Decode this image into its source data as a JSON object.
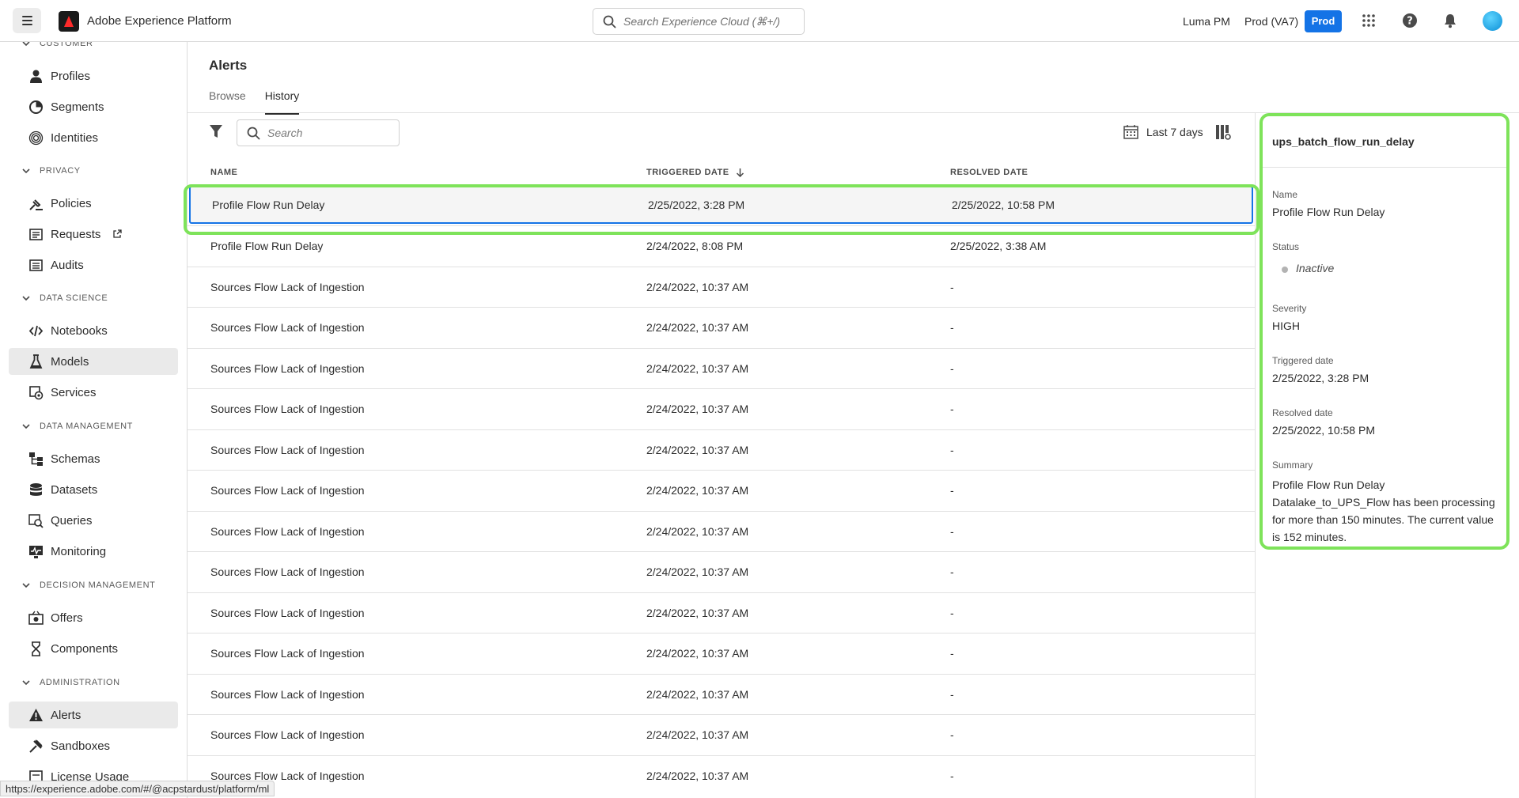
{
  "topbar": {
    "app_title": "Adobe Experience Platform",
    "search_placeholder": "Search Experience Cloud (⌘+/)",
    "org_name": "Luma PM",
    "sandbox_name": "Prod (VA7)",
    "env_badge": "Prod"
  },
  "sidebar": {
    "sections": [
      {
        "title": "CUSTOMER"
      },
      {
        "title": "PRIVACY"
      },
      {
        "title": "DATA SCIENCE"
      },
      {
        "title": "DATA MANAGEMENT"
      },
      {
        "title": "DECISION MANAGEMENT"
      },
      {
        "title": "ADMINISTRATION"
      }
    ],
    "items": {
      "profiles": "Profiles",
      "segments": "Segments",
      "identities": "Identities",
      "policies": "Policies",
      "requests": "Requests",
      "audits": "Audits",
      "notebooks": "Notebooks",
      "models": "Models",
      "services": "Services",
      "schemas": "Schemas",
      "datasets": "Datasets",
      "queries": "Queries",
      "monitoring": "Monitoring",
      "offers": "Offers",
      "components": "Components",
      "alerts": "Alerts",
      "sandboxes": "Sandboxes",
      "license_usage": "License Usage"
    },
    "active_item": "Models"
  },
  "main": {
    "page_title": "Alerts",
    "tabs": [
      "Browse",
      "History"
    ],
    "active_tab": "History",
    "search_placeholder": "Search",
    "date_range": "Last 7 days",
    "columns": {
      "name": "NAME",
      "triggered": "TRIGGERED DATE",
      "resolved": "RESOLVED DATE"
    },
    "rows": [
      {
        "name": "Profile Flow Run Delay",
        "triggered": "2/25/2022, 3:28 PM",
        "resolved": "2/25/2022, 10:58 PM"
      },
      {
        "name": "Profile Flow Run Delay",
        "triggered": "2/24/2022, 8:08 PM",
        "resolved": "2/25/2022, 3:38 AM"
      },
      {
        "name": "Sources Flow Lack of Ingestion",
        "triggered": "2/24/2022, 10:37 AM",
        "resolved": "-"
      },
      {
        "name": "Sources Flow Lack of Ingestion",
        "triggered": "2/24/2022, 10:37 AM",
        "resolved": "-"
      },
      {
        "name": "Sources Flow Lack of Ingestion",
        "triggered": "2/24/2022, 10:37 AM",
        "resolved": "-"
      },
      {
        "name": "Sources Flow Lack of Ingestion",
        "triggered": "2/24/2022, 10:37 AM",
        "resolved": "-"
      },
      {
        "name": "Sources Flow Lack of Ingestion",
        "triggered": "2/24/2022, 10:37 AM",
        "resolved": "-"
      },
      {
        "name": "Sources Flow Lack of Ingestion",
        "triggered": "2/24/2022, 10:37 AM",
        "resolved": "-"
      },
      {
        "name": "Sources Flow Lack of Ingestion",
        "triggered": "2/24/2022, 10:37 AM",
        "resolved": "-"
      },
      {
        "name": "Sources Flow Lack of Ingestion",
        "triggered": "2/24/2022, 10:37 AM",
        "resolved": "-"
      },
      {
        "name": "Sources Flow Lack of Ingestion",
        "triggered": "2/24/2022, 10:37 AM",
        "resolved": "-"
      },
      {
        "name": "Sources Flow Lack of Ingestion",
        "triggered": "2/24/2022, 10:37 AM",
        "resolved": "-"
      },
      {
        "name": "Sources Flow Lack of Ingestion",
        "triggered": "2/24/2022, 10:37 AM",
        "resolved": "-"
      },
      {
        "name": "Sources Flow Lack of Ingestion",
        "triggered": "2/24/2022, 10:37 AM",
        "resolved": "-"
      },
      {
        "name": "Sources Flow Lack of Ingestion",
        "triggered": "2/24/2022, 10:37 AM",
        "resolved": "-"
      }
    ]
  },
  "detail": {
    "title": "ups_batch_flow_run_delay",
    "name_label": "Name",
    "name_value": "Profile Flow Run Delay",
    "status_label": "Status",
    "status_value": "Inactive",
    "severity_label": "Severity",
    "severity_value": "HIGH",
    "triggered_label": "Triggered date",
    "triggered_value": "2/25/2022, 3:28 PM",
    "resolved_label": "Resolved date",
    "resolved_value": "2/25/2022, 10:58 PM",
    "summary_label": "Summary",
    "summary_value": "Profile Flow Run Delay Datalake_to_UPS_Flow has been processing for more than 150 minutes. The current value is 152 minutes."
  },
  "statusbar": {
    "url": "https://experience.adobe.com/#/@acpstardust/platform/ml"
  },
  "colors": {
    "accent": "#1473e6",
    "highlight": "#7ee35a",
    "status_inactive": "#b3b3b3"
  }
}
